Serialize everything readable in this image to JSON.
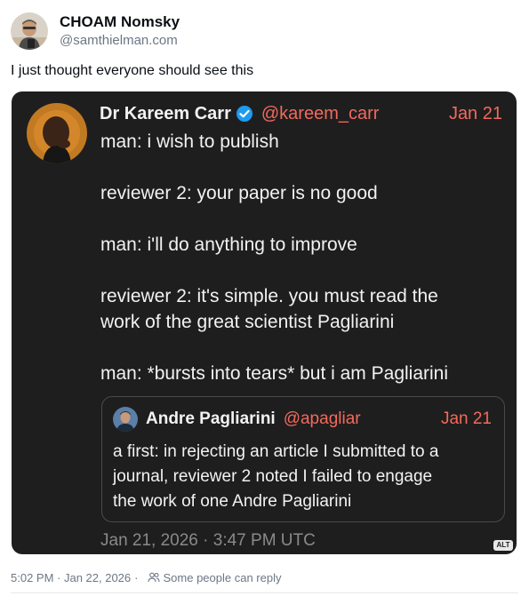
{
  "post": {
    "author_name": "CHOAM Nomsky",
    "author_handle": "@samthielman.com",
    "text": "I just thought everyone should see this",
    "timestamp": "5:02 PM · Jan 22, 2026",
    "reply_setting": "Some people can reply"
  },
  "screenshot": {
    "author_name": "Dr Kareem Carr",
    "author_handle": "@kareem_carr",
    "date": "Jan 21",
    "lines": [
      "man: i wish to publish",
      "",
      "reviewer 2: your paper is no good",
      "",
      "man: i'll do anything to improve",
      "",
      "reviewer 2: it's simple. you must read the",
      "work of the great scientist Pagliarini",
      "",
      "man: *bursts into tears*  but i am Pagliarini"
    ],
    "quote": {
      "author_name": "Andre Pagliarini",
      "author_handle": "@apagliar",
      "date": "Jan 21",
      "lines": [
        "a first: in rejecting an article I submitted to a",
        "journal, reviewer 2 noted I failed to engage",
        "the work of one Andre Pagliarini"
      ]
    },
    "timestamp": "Jan 21, 2026 · 3:47 PM UTC",
    "alt_badge": "ALT"
  },
  "icons": {
    "verified": "verified-badge-icon",
    "reply_audience": "people-icon"
  },
  "colors": {
    "screenshot_bg": "#1f1e1f",
    "accent_handle": "#f26a5c",
    "verified_blue": "#1d9bf0",
    "meta_gray": "#6b7785"
  }
}
